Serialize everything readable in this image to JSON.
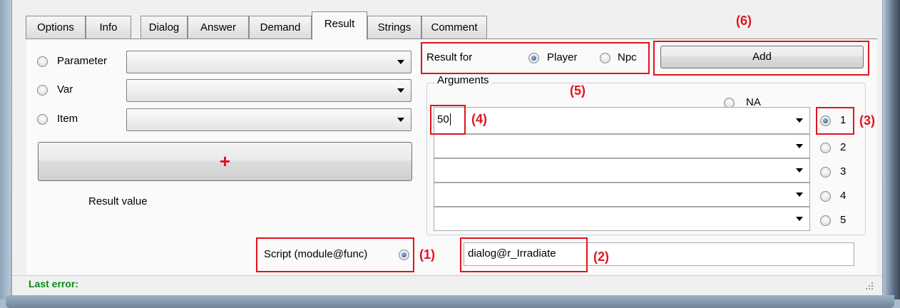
{
  "tabs": [
    "Options",
    "Info",
    "Dialog",
    "Answer",
    "Demand",
    "Result",
    "Strings",
    "Comment"
  ],
  "left": {
    "parameter_label": "Parameter",
    "var_label": "Var",
    "item_label": "Item",
    "plus_label": "+",
    "result_value_label": "Result value"
  },
  "result_for": {
    "label": "Result for",
    "player_label": "Player",
    "npc_label": "Npc",
    "selected": "Player"
  },
  "add_label": "Add",
  "arguments": {
    "label": "Arguments",
    "na_label": "NA",
    "first_value": "50",
    "radio_labels": [
      "1",
      "2",
      "3",
      "4",
      "5"
    ],
    "selected": "1"
  },
  "script": {
    "label": "Script (module@func)",
    "value": "dialog@r_Irradiate"
  },
  "annotations": [
    "(1)",
    "(2)",
    "(3)",
    "(4)",
    "(5)",
    "(6)"
  ],
  "status": {
    "last_error_label": "Last error:"
  },
  "colors": {
    "annotation_red": "#e0141e",
    "status_green": "#0a8a1a",
    "radio_fill": "#1f4f91"
  }
}
